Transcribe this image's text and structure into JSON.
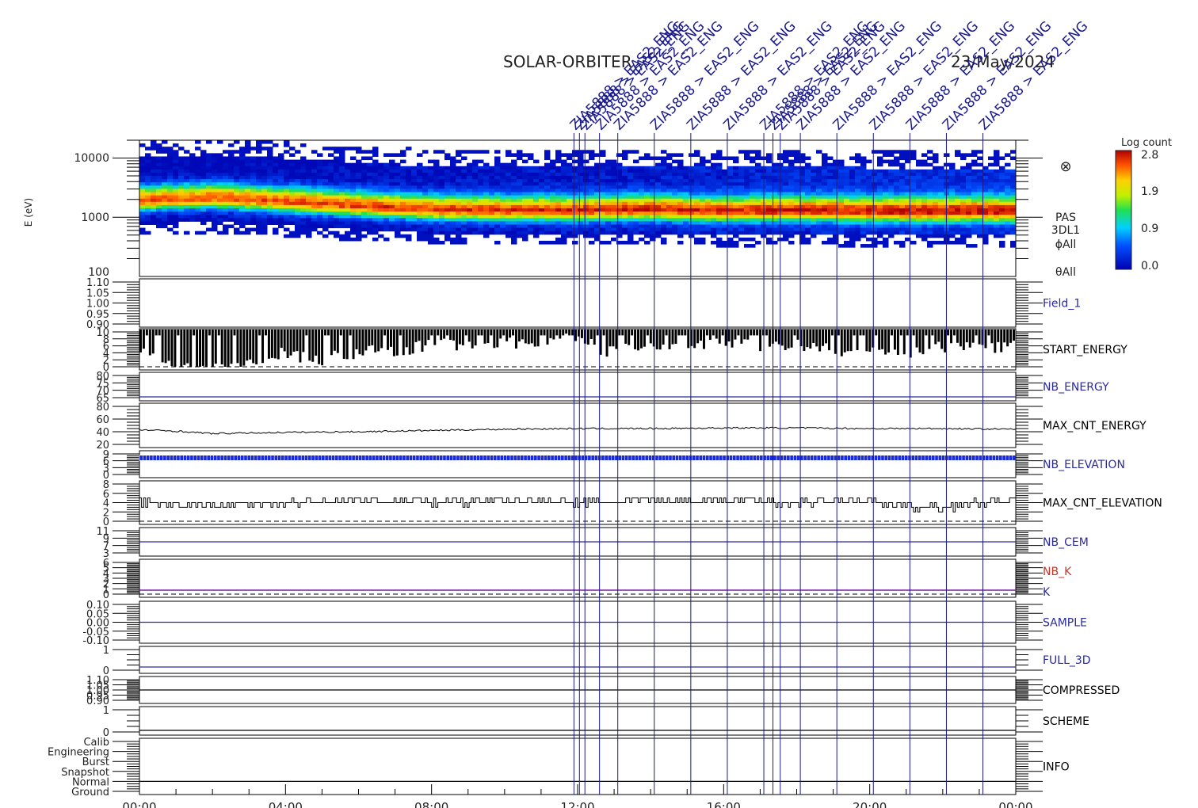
{
  "header": {
    "title": "SOLAR-ORBITER",
    "date": "23/May/2024"
  },
  "colorbar": {
    "title": "Log count",
    "ticks": [
      "2.8",
      "1.9",
      "0.9",
      "0.0"
    ],
    "min": 0.0,
    "max": 2.8
  },
  "spectrogram": {
    "ylabel": "E (eV)",
    "ytick_labels": [
      "10000",
      "1000",
      "100"
    ],
    "right_labels": [
      "PAS",
      "3DL1",
      "ϕAll",
      "θAll"
    ],
    "symbol": "⊗"
  },
  "panels": [
    {
      "id": "field1",
      "label": "Field_1",
      "label_color": "#2a2aa0",
      "ticks": [
        "1.10",
        "1.05",
        "1.00",
        "0.95",
        "0.90"
      ]
    },
    {
      "id": "start_energy",
      "label": "START_ENERGY",
      "label_color": "#000000",
      "ticks": [
        "10",
        "8",
        "6",
        "4",
        "2",
        "0"
      ]
    },
    {
      "id": "nb_energy",
      "label": "NB_ENERGY",
      "label_color": "#2a2aa0",
      "ticks": [
        "80",
        "75",
        "70",
        "65"
      ]
    },
    {
      "id": "max_cnt_energy",
      "label": "MAX_CNT_ENERGY",
      "label_color": "#000000",
      "ticks": [
        "80",
        "60",
        "40",
        "20"
      ]
    },
    {
      "id": "nb_elevation",
      "label": "NB_ELEVATION",
      "label_color": "#2a2aa0",
      "ticks": [
        "9",
        "6",
        "3",
        "0"
      ]
    },
    {
      "id": "max_cnt_elevation",
      "label": "MAX_CNT_ELEVATION",
      "label_color": "#000000",
      "ticks": [
        "8",
        "6",
        "4",
        "2",
        "0"
      ]
    },
    {
      "id": "nb_cem",
      "label": "NB_CEM",
      "label_color": "#2a2aa0",
      "ticks": [
        "11",
        "9",
        "7",
        "3"
      ]
    },
    {
      "id": "nb_k",
      "label": "NB_K",
      "label_color": "#c0392b",
      "label2": "K",
      "label2_color": "#2a2aa0",
      "ticks": [
        "6",
        "5",
        "4",
        "3",
        "2",
        "1",
        "0"
      ]
    },
    {
      "id": "sample",
      "label": "SAMPLE",
      "label_color": "#2a2aa0",
      "ticks": [
        "0.10",
        "0.05",
        "0.00",
        "-0.05",
        "-0.10"
      ]
    },
    {
      "id": "full_3d",
      "label": "FULL_3D",
      "label_color": "#2a2aa0",
      "ticks": [
        "1",
        "0"
      ]
    },
    {
      "id": "compressed",
      "label": "COMPRESSED",
      "label_color": "#000000",
      "ticks": [
        "1.10",
        "1.05",
        "1.00",
        "0.95",
        "0.90"
      ]
    },
    {
      "id": "scheme",
      "label": "SCHEME",
      "label_color": "#000000",
      "ticks": [
        "1",
        "0"
      ]
    },
    {
      "id": "info",
      "label": "INFO",
      "label_color": "#000000",
      "ticks": [
        "Calib",
        "Engineering",
        "Burst",
        "Snapshot",
        "Normal",
        "Ground"
      ]
    }
  ],
  "time_axis": {
    "labels": [
      "00:00",
      "04:00",
      "08:00",
      "12:00",
      "16:00",
      "20:00",
      "00:00"
    ],
    "start_hour": 0,
    "end_hour": 24
  },
  "events": {
    "color": "#1a1a8c",
    "hours": [
      11.9,
      12.05,
      12.2,
      12.6,
      13.1,
      14.1,
      15.1,
      16.1,
      17.1,
      17.35,
      17.55,
      18.1,
      19.1,
      20.1,
      21.1,
      22.1,
      23.1
    ],
    "labels": [
      "ZIA5888 > EAS2_ENG",
      "ZIA5888 > EAS2_ENG",
      "ZIA5888 > EAS2_ENG",
      "ZIA5888 > EAS2_ENG",
      "ZIA5888 > EAS2_ENG",
      "ZIA5888 > EAS2_ENG",
      "ZIA5888 > EAS2_ENG",
      "ZIA5888 > EAS2_ENG",
      "ZIA5888 > EAS2_ENG",
      "ZIA5888 > EAS2_ENG",
      "ZIA5888 > EAS2_ENG",
      "ZIA5888 > EAS2_ENG",
      "ZIA5888 > EAS2_ENG",
      "ZIA5888 > EAS2_ENG",
      "ZIA5888 > EAS2_ENG",
      "ZIA5888 > EAS2_ENG",
      "ZIA5888 > EAS2_ENG"
    ]
  },
  "chart_data": [
    {
      "type": "heatmap",
      "name": "PAS 3DL1 energy spectrogram",
      "y_scale": "log",
      "ylim": [
        100,
        20000
      ],
      "peak_energy_eV": [
        {
          "hour": 0,
          "value": 2000
        },
        {
          "hour": 2,
          "value": 2200
        },
        {
          "hour": 4,
          "value": 1900
        },
        {
          "hour": 6,
          "value": 1600
        },
        {
          "hour": 8,
          "value": 1400
        },
        {
          "hour": 10,
          "value": 1350
        },
        {
          "hour": 12,
          "value": 1350
        },
        {
          "hour": 14,
          "value": 1400
        },
        {
          "hour": 16,
          "value": 1300
        },
        {
          "hour": 18,
          "value": 1350
        },
        {
          "hour": 20,
          "value": 1300
        },
        {
          "hour": 22,
          "value": 1300
        },
        {
          "hour": 24,
          "value": 1300
        }
      ]
    },
    {
      "type": "line",
      "name": "MAX_CNT_ENERGY",
      "ylim": [
        20,
        80
      ],
      "points": [
        {
          "hour": 0,
          "value": 43
        },
        {
          "hour": 1,
          "value": 41
        },
        {
          "hour": 2,
          "value": 37
        },
        {
          "hour": 3,
          "value": 38
        },
        {
          "hour": 4,
          "value": 39
        },
        {
          "hour": 6,
          "value": 40
        },
        {
          "hour": 8,
          "value": 42
        },
        {
          "hour": 10,
          "value": 44
        },
        {
          "hour": 12,
          "value": 45
        },
        {
          "hour": 14,
          "value": 45
        },
        {
          "hour": 16,
          "value": 46
        },
        {
          "hour": 18,
          "value": 46
        },
        {
          "hour": 20,
          "value": 45
        },
        {
          "hour": 22,
          "value": 45
        },
        {
          "hour": 24,
          "value": 44
        }
      ]
    },
    {
      "type": "line",
      "name": "MAX_CNT_ELEVATION",
      "ylim": [
        0,
        8
      ],
      "points": [
        {
          "hour": 0,
          "value": 4
        },
        {
          "hour": 1,
          "value": 3.5
        },
        {
          "hour": 2,
          "value": 3.5
        },
        {
          "hour": 4,
          "value": 4
        },
        {
          "hour": 6,
          "value": 4.5
        },
        {
          "hour": 8,
          "value": 4
        },
        {
          "hour": 10,
          "value": 4.5
        },
        {
          "hour": 12,
          "value": 4
        },
        {
          "hour": 14,
          "value": 4.5
        },
        {
          "hour": 16,
          "value": 4.5
        },
        {
          "hour": 18,
          "value": 4
        },
        {
          "hour": 20,
          "value": 4.5
        },
        {
          "hour": 21,
          "value": 3
        },
        {
          "hour": 22,
          "value": 3
        },
        {
          "hour": 23,
          "value": 4
        },
        {
          "hour": 24,
          "value": 4.5
        }
      ]
    },
    {
      "type": "bar",
      "name": "START_ENERGY",
      "ylim": [
        0,
        10
      ],
      "baseline": 10,
      "points": [
        {
          "hour": 0,
          "value": 5
        },
        {
          "hour": 1,
          "value": 0
        },
        {
          "hour": 2,
          "value": 0
        },
        {
          "hour": 3,
          "value": 1
        },
        {
          "hour": 4,
          "value": 4
        },
        {
          "hour": 5,
          "value": 2
        },
        {
          "hour": 6,
          "value": 4
        },
        {
          "hour": 7,
          "value": 5
        },
        {
          "hour": 8,
          "value": 6
        },
        {
          "hour": 10,
          "value": 7
        },
        {
          "hour": 12,
          "value": 8
        },
        {
          "hour": 13,
          "value": 4
        },
        {
          "hour": 14,
          "value": 6
        },
        {
          "hour": 16,
          "value": 7
        },
        {
          "hour": 18,
          "value": 6
        },
        {
          "hour": 20,
          "value": 4
        },
        {
          "hour": 21,
          "value": 3
        },
        {
          "hour": 22,
          "value": 6
        },
        {
          "hour": 24,
          "value": 6
        }
      ]
    }
  ]
}
